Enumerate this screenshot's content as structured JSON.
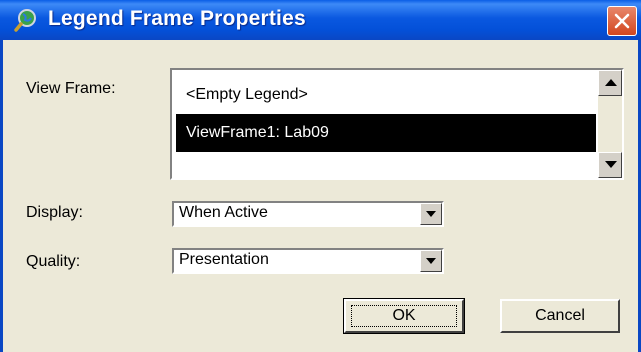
{
  "window": {
    "title": "Legend Frame Properties",
    "title_icon": "globe-magnifier-icon",
    "close_icon": "close-icon",
    "accent_color": "#0a58e0"
  },
  "form": {
    "view_frame_label": "View Frame:",
    "view_frame_items": [
      "<Empty Legend>",
      "ViewFrame1: Lab09"
    ],
    "view_frame_selected_index": 1,
    "display_label": "Display:",
    "display_value": "When Active",
    "quality_label": "Quality:",
    "quality_value": "Presentation"
  },
  "buttons": {
    "ok": "OK",
    "cancel": "Cancel"
  }
}
